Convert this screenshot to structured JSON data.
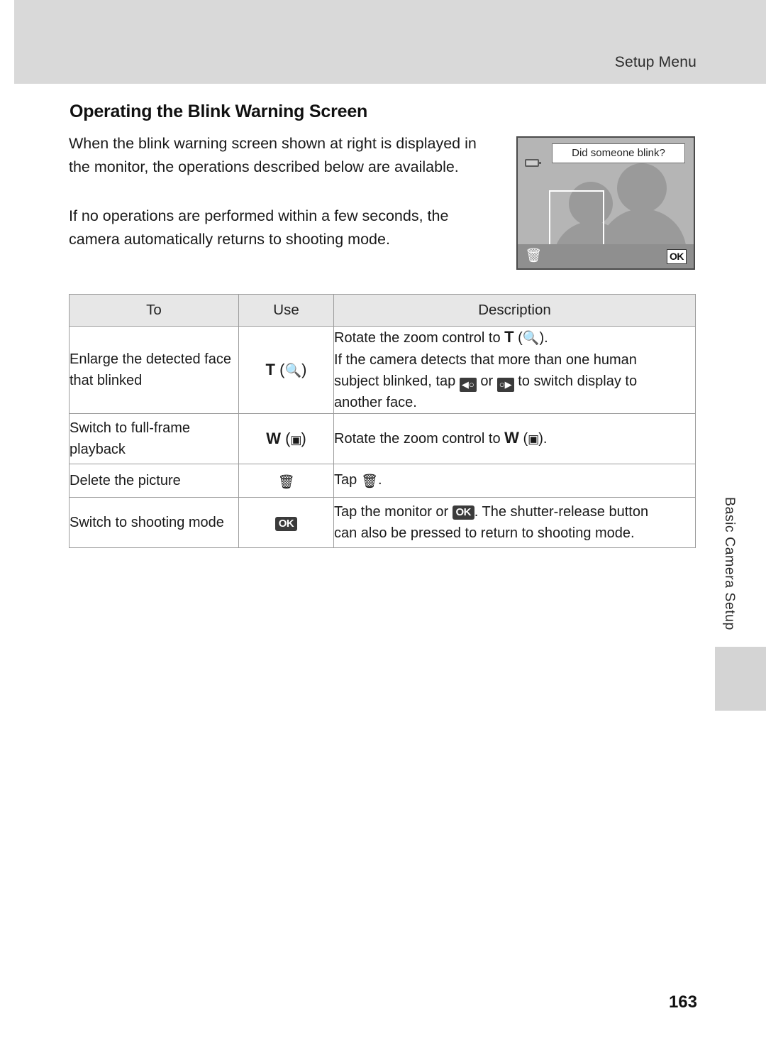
{
  "header": {
    "title": "Setup Menu"
  },
  "section": {
    "title": "Operating the Blink Warning Screen",
    "paragraph1": "When the blink warning screen shown at right is displayed in the monitor, the operations described below are available.",
    "paragraph2": "If no operations are performed within a few seconds, the camera automatically returns to shooting mode."
  },
  "monitor": {
    "banner": "Did someone blink?",
    "battery_icon": "battery-icon",
    "trash_icon": "trash-icon",
    "ok_label": "OK"
  },
  "table": {
    "headers": [
      "To",
      "Use",
      "Description"
    ],
    "rows": [
      {
        "to": "Enlarge the detected face that blinked",
        "use_control": "T",
        "use_glyph": "magnify-icon",
        "desc_line1": "Rotate the zoom control to T (magnify).",
        "desc_line2": "If the camera detects that more than one human",
        "desc_line3": "subject blinked, tap (prev-face) or (next-face) to switch display to",
        "desc_line4": "another face."
      },
      {
        "to": "Switch to full-frame playback",
        "use_control": "W",
        "use_glyph": "thumbnail-icon",
        "desc_line1": "Rotate the zoom control to W (thumbnail)."
      },
      {
        "to": "Delete the picture",
        "use_control": "trash-icon",
        "desc_line1": "Tap (trash-icon)."
      },
      {
        "to": "Switch to shooting mode",
        "use_control": "OK",
        "desc_line1": "Tap the monitor or OK. The shutter-release button",
        "desc_line2": "can also be pressed to return to shooting mode."
      }
    ]
  },
  "sidebar": {
    "vertical_tab_label": "Basic Camera Setup"
  },
  "footer": {
    "page_number": "163"
  }
}
